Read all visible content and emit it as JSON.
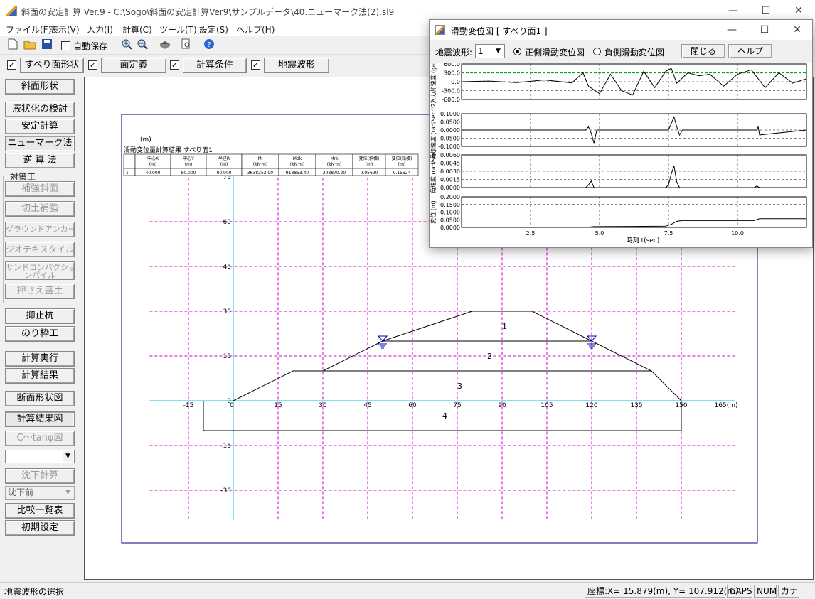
{
  "window": {
    "title": "斜面の安定計算 Ver.9 - C:\\Sogo\\斜面の安定計算Ver9\\サンプルデータ\\40.ニューマーク法(2).sl9",
    "minimize": "—",
    "maximize": "☐",
    "close": "✕"
  },
  "menu": [
    "ファイル(F)",
    "表示(V)",
    "入力(I)",
    "計算(C)",
    "ツール(T)",
    "設定(S)",
    "ヘルプ(H)"
  ],
  "toolbar": {
    "autosave_label": "自動保存",
    "autosave_checked": false
  },
  "tabs": [
    {
      "label": "すべり面形状",
      "checked": true
    },
    {
      "label": "面定義",
      "checked": true
    },
    {
      "label": "計算条件",
      "checked": true
    },
    {
      "label": "地震波形",
      "checked": true
    }
  ],
  "sidebar": {
    "slope_shape": "斜面形状",
    "liquefaction": "液状化の検討",
    "stability": "安定計算",
    "newmark": "ニューマーク法",
    "back_calc": "逆 算 法",
    "countermeasure_label": "対策工",
    "reinforce_slope": "補強斜面",
    "cut_reinforce": "切土補強",
    "ground_anchor": "グラウンドアンカー",
    "geotextile": "ジオテキスタイル",
    "sand_compaction_1": "サンドコンパクショ",
    "sand_compaction_2": "ンパイル",
    "counterweight": "押さえ盛土",
    "stabilizing_pile": "抑止杭",
    "frame": "のり枠工",
    "run_calc": "計算実行",
    "calc_result": "計算結果",
    "section_diagram": "断面形状図",
    "result_diagram": "計算結果図",
    "c_tan_diagram": "C〜tanφ図",
    "select_value": "",
    "settlement_calc": "沈下計算",
    "settlement_select": "沈下前",
    "comparison": "比較一覧表",
    "initial_settings": "初期設定"
  },
  "drawing": {
    "unit": "(m)",
    "table_title": "滑動変位量計算結果  すべり面1",
    "table_headers": [
      [
        "",
        ""
      ],
      [
        "中心X",
        "(m)"
      ],
      [
        "中心Y",
        "(m)"
      ],
      [
        "半径R",
        "(m)"
      ],
      [
        "Mj",
        "(kN·m)"
      ],
      [
        "Mdk",
        "(kN·m)"
      ],
      [
        "Mrk",
        "(kN·m)"
      ],
      [
        "変位(斜横)",
        "(m)"
      ],
      [
        "変位(鉛横)",
        "(m)"
      ]
    ],
    "table_row": [
      "1",
      "40.000",
      "80.000",
      "80.000",
      "3638252.90",
      "918853.40",
      "208870.20",
      "0.05690",
      "0.15524"
    ],
    "x_ticks": [
      "-15",
      "0",
      "15",
      "30",
      "45",
      "60",
      "75",
      "90",
      "105",
      "120",
      "135",
      "150",
      "165"
    ],
    "x_unit": "(m)",
    "y_ticks": [
      "75",
      "60",
      "45",
      "30",
      "15",
      "0",
      "-15",
      "-30"
    ],
    "layer_labels": [
      "1",
      "2",
      "3",
      "4"
    ]
  },
  "popup": {
    "title": "滑動変位図   [ すべり面1 ]",
    "waveform_label": "地震波形:",
    "waveform_value": "1",
    "radio_positive": "正側滑動変位図",
    "radio_negative": "負側滑動変位図",
    "radio_positive_selected": true,
    "close_button": "閉じる",
    "help_button": "ヘルプ",
    "xlabel": "時刻 t(sec)",
    "x_ticks": [
      "2.5",
      "5.0",
      "7.5",
      "10.0"
    ]
  },
  "chart_data": [
    {
      "type": "line",
      "ylabel": "入力加速度 (gal)",
      "y_ticks": [
        "600.0",
        "300.0",
        "0.0",
        "-300.0",
        "-600.0"
      ],
      "ylim": [
        -600,
        600
      ],
      "threshold": 300,
      "x": [
        0,
        1,
        2,
        3,
        4,
        4.4,
        4.6,
        5,
        5.4,
        5.8,
        6.2,
        6.6,
        7,
        7.4,
        7.6,
        7.8,
        8.2,
        8.6,
        9,
        9.5,
        10,
        10.5,
        11,
        11.5,
        12,
        12.5
      ],
      "values": [
        0,
        20,
        -30,
        60,
        -40,
        300,
        -150,
        -400,
        250,
        -300,
        -450,
        350,
        -200,
        350,
        450,
        -50,
        300,
        200,
        250,
        -150,
        250,
        400,
        -200,
        300,
        -50,
        100
      ]
    },
    {
      "type": "line",
      "ylabel": "角加速度 (rad/sec^2)",
      "y_ticks": [
        "0.1000",
        "0.0500",
        "0.0000",
        "-0.0500",
        "-0.1000"
      ],
      "ylim": [
        -0.1,
        0.1
      ],
      "x": [
        0,
        4.5,
        4.6,
        4.7,
        4.8,
        4.9,
        7.5,
        7.6,
        7.7,
        7.8,
        7.9,
        8.0,
        10.7,
        10.75,
        10.8,
        12.5
      ],
      "values": [
        0,
        0,
        0.02,
        -0.02,
        -0.08,
        0,
        0,
        0.04,
        0.08,
        0.02,
        -0.03,
        0,
        0,
        0.02,
        -0.03,
        0
      ]
    },
    {
      "type": "line",
      "ylabel": "角速度 (rad/sec)",
      "y_ticks": [
        "0.0060",
        "0.0045",
        "0.0030",
        "0.0015",
        "0.0000"
      ],
      "ylim": [
        0,
        0.006
      ],
      "x": [
        0,
        4.5,
        4.6,
        4.7,
        4.8,
        7.4,
        7.5,
        7.6,
        7.7,
        7.8,
        7.9,
        10.6,
        10.7,
        10.8,
        12.5
      ],
      "values": [
        0,
        0,
        0.0005,
        0.0012,
        0,
        0,
        0.0005,
        0.0025,
        0.004,
        0.001,
        0,
        0,
        0.0003,
        0,
        0
      ]
    },
    {
      "type": "line",
      "ylabel": "変位 (m)",
      "y_ticks": [
        "0.2000",
        "0.1500",
        "0.1000",
        "0.0500",
        "0.0000"
      ],
      "ylim": [
        0,
        0.2
      ],
      "x": [
        0,
        4.5,
        4.8,
        7.4,
        7.6,
        7.8,
        8.0,
        10.6,
        10.8,
        12.5
      ],
      "values": [
        0,
        0,
        0.005,
        0.008,
        0.02,
        0.04,
        0.045,
        0.045,
        0.057,
        0.057
      ]
    }
  ],
  "status": {
    "message": "地震波形の選択",
    "coords": "座標:X=  15.879(m), Y= 107.912(m)",
    "caps": "CAPS",
    "num": "NUM",
    "kana": "カナ"
  }
}
